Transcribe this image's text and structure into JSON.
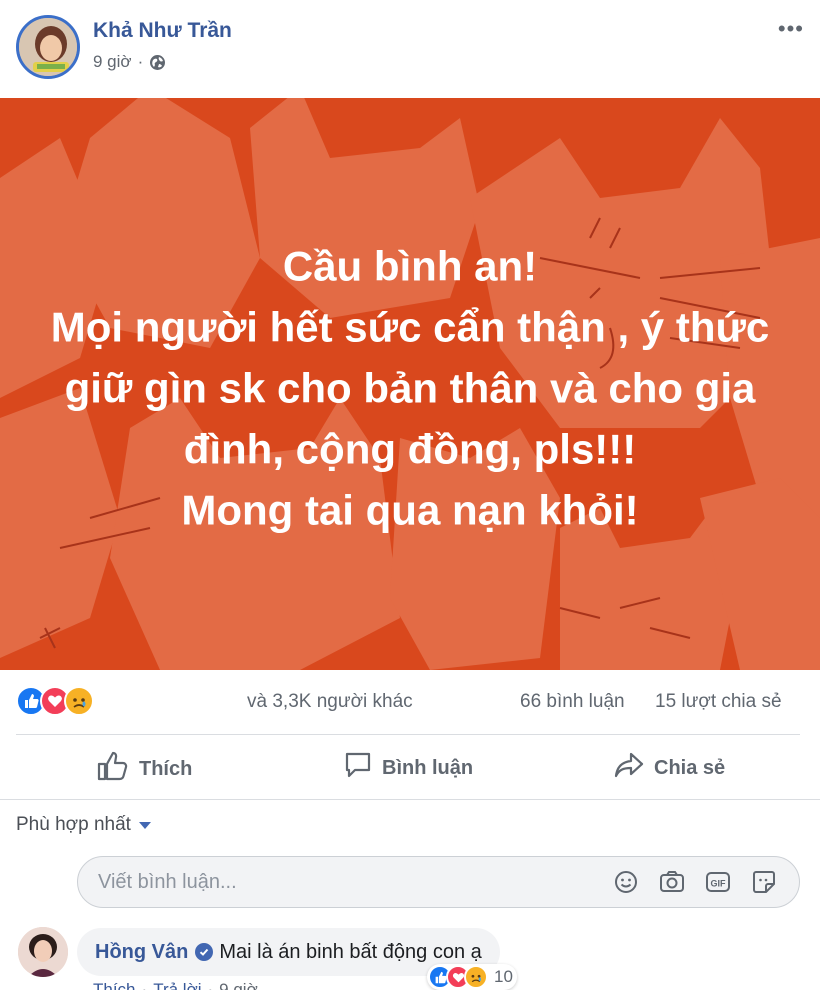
{
  "post": {
    "author": "Khả Như Trần",
    "time": "9 giờ",
    "separator": "·",
    "more_label": "•••",
    "banner_text": "Cầu bình an!\nMọi người hết sức cẩn thận , ý thức giữ gìn sk cho bản thân và cho gia đình, cộng đồng, pls!!!\nMong tai qua nạn khỏi!",
    "banner_color": "#d9481d",
    "banner_pattern_color": "#e36b45"
  },
  "stats": {
    "others": "và 3,3K người khác",
    "comments": "66 bình luận",
    "shares": "15 lượt chia sẻ",
    "reactions": [
      "like-icon",
      "love-icon",
      "sad-icon"
    ]
  },
  "actions": {
    "like": "Thích",
    "comment": "Bình luận",
    "share": "Chia sẻ"
  },
  "comments": {
    "sort_label": "Phù hợp nhất",
    "composer_placeholder": "Viết bình luận...",
    "composer_value": "",
    "composer_icons": [
      "emoji-icon",
      "camera-icon",
      "gif-icon",
      "sticker-icon"
    ],
    "items": [
      {
        "name": "Hồng Vân",
        "text": "Mai là án binh bất động con ạ",
        "reaction_count": "10",
        "like_label": "Thích",
        "reply_label": "Trả lời",
        "time": "9 giờ"
      }
    ]
  },
  "colors": {
    "link": "#385898",
    "accent": "#4267b2",
    "like": "#1877f2",
    "love": "#f33e58",
    "sad": "#f7b125"
  }
}
